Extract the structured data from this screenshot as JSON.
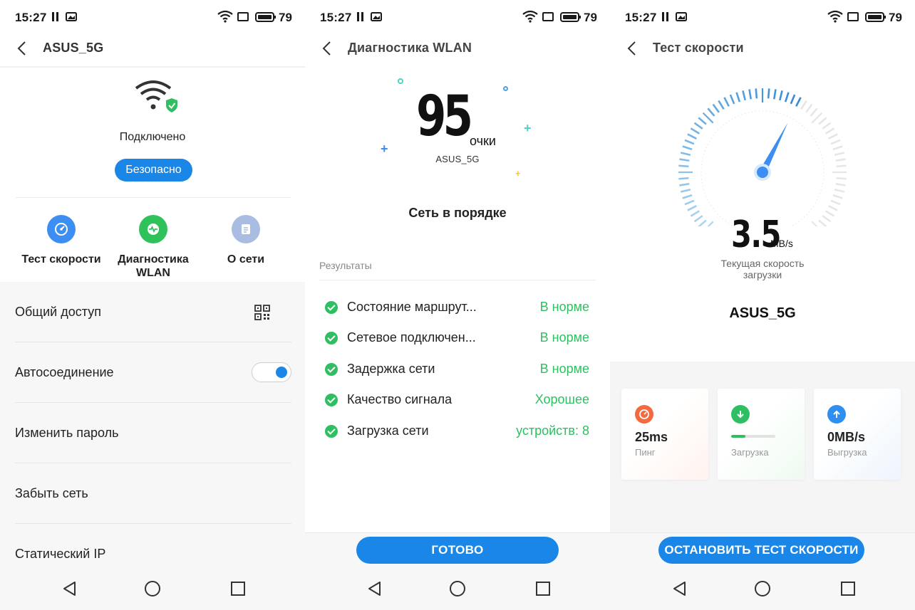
{
  "status_bar": {
    "time": "15:27",
    "battery": "79"
  },
  "screen1": {
    "header_title": "ASUS_5G",
    "status": "Подключено",
    "security_badge": "Безопасно",
    "quick_actions": [
      {
        "label": "Тест скорости",
        "icon": "speedometer-icon"
      },
      {
        "label": "Диагностика WLAN",
        "icon": "pulse-icon"
      },
      {
        "label": "О сети",
        "icon": "document-icon"
      }
    ],
    "settings": [
      {
        "label": "Общий доступ",
        "icon": "qr-code-icon"
      },
      {
        "label": "Автосоединение",
        "toggle_on": true
      },
      {
        "label": "Изменить пароль"
      },
      {
        "label": "Забыть сеть"
      },
      {
        "label": "Статический IP"
      }
    ]
  },
  "screen2": {
    "header_title": "Диагностика WLAN",
    "score": "95",
    "score_unit": "очки",
    "ssid": "ASUS_5G",
    "summary": "Сеть в порядке",
    "results_heading": "Результаты",
    "results": [
      {
        "name": "Состояние маршрут...",
        "status": "В норме"
      },
      {
        "name": "Сетевое подключен...",
        "status": "В норме"
      },
      {
        "name": "Задержка сети",
        "status": "В норме"
      },
      {
        "name": "Качество сигнала",
        "status": "Хорошее"
      },
      {
        "name": "Загрузка сети",
        "status": "устройств: 8"
      }
    ],
    "done_button": "ГОТОВО"
  },
  "screen3": {
    "header_title": "Тест скорости",
    "speed_value": "3.5",
    "speed_unit": "MB/s",
    "speed_label": "Текущая скорость загрузки",
    "ssid": "ASUS_5G",
    "cards": [
      {
        "value": "25ms",
        "caption": "Пинг",
        "icon": "ping-icon",
        "color": "#f26a3d"
      },
      {
        "value": "",
        "caption": "Загрузка",
        "icon": "download-icon",
        "color": "#2fbf62",
        "progress": 0.33
      },
      {
        "value": "0MB/s",
        "caption": "Выгрузка",
        "icon": "upload-icon",
        "color": "#2e8ff0"
      }
    ],
    "stop_button": "ОСТАНОВИТЬ ТЕСТ СКОРОСТИ"
  },
  "colors": {
    "accent_blue": "#1a87e8",
    "ok_green": "#2fbf62"
  }
}
